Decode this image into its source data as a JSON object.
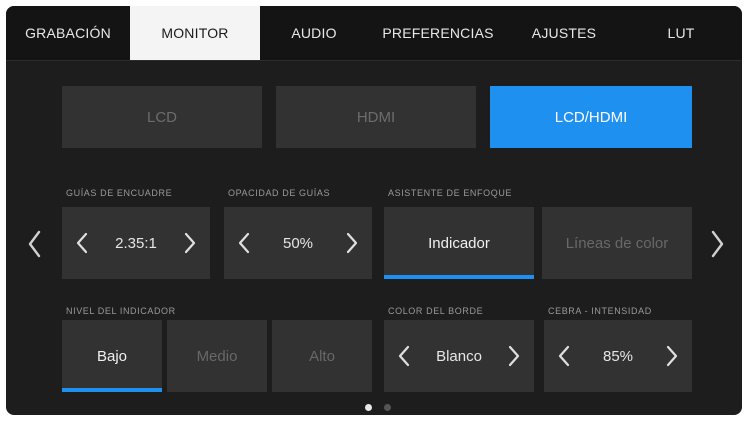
{
  "tabs": [
    {
      "label": "GRABACIÓN",
      "active": false
    },
    {
      "label": "MONITOR",
      "active": true
    },
    {
      "label": "AUDIO",
      "active": false
    },
    {
      "label": "PREFERENCIAS",
      "active": false
    },
    {
      "label": "AJUSTES",
      "active": false
    },
    {
      "label": "LUT",
      "active": false
    }
  ],
  "outputs": [
    {
      "label": "LCD",
      "active": false
    },
    {
      "label": "HDMI",
      "active": false
    },
    {
      "label": "LCD/HDMI",
      "active": true
    }
  ],
  "frame_guides": {
    "label": "GUÍAS DE ENCUADRE",
    "value": "2.35:1"
  },
  "guide_opacity": {
    "label": "OPACIDAD DE GUÍAS",
    "value": "50%"
  },
  "focus_assist": {
    "label": "ASISTENTE DE ENFOQUE",
    "options": [
      "Indicador",
      "Líneas de color"
    ],
    "selected": "Indicador"
  },
  "indicator_level": {
    "label": "NIVEL DEL INDICADOR",
    "options": [
      "Bajo",
      "Medio",
      "Alto"
    ],
    "selected": "Bajo"
  },
  "border_color": {
    "label": "COLOR DEL BORDE",
    "value": "Blanco"
  },
  "zebra": {
    "label": "CEBRA - INTENSIDAD",
    "value": "85%"
  },
  "pagination": {
    "pages": 2,
    "current": 1
  },
  "colors": {
    "accent": "#1e90f0",
    "panel": "#323232",
    "background": "#1d1d1d",
    "tab_active": "#f4f4f4"
  },
  "icons": {
    "left": "chevron-left-icon",
    "right": "chevron-right-icon"
  }
}
